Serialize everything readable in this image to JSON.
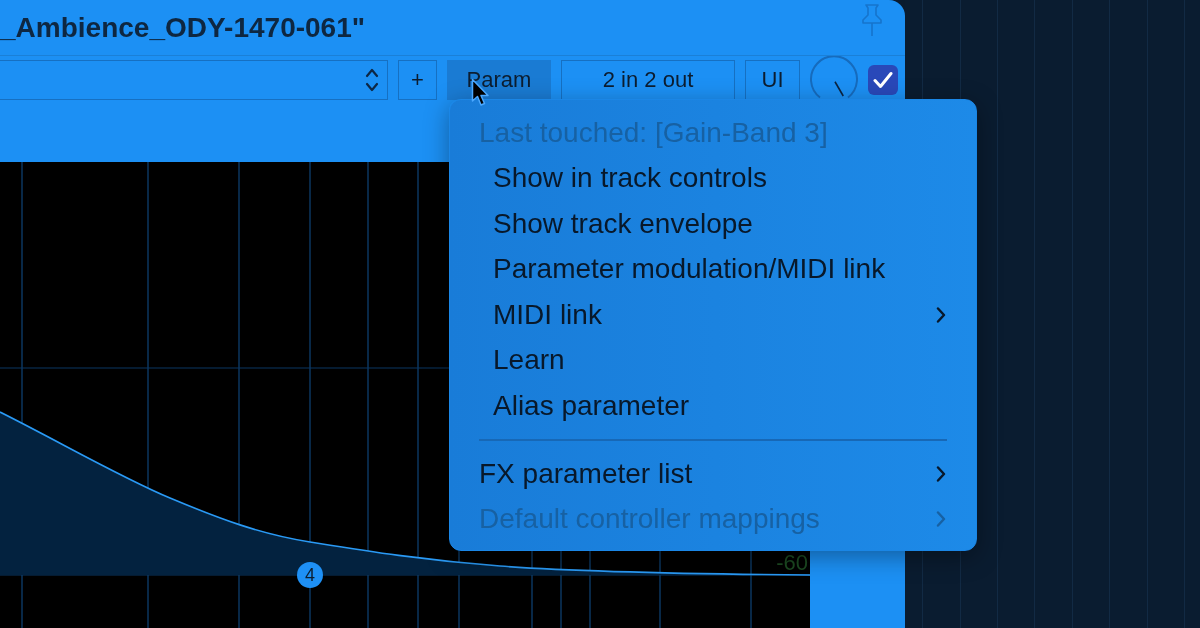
{
  "window": {
    "title": "_Ambience_ODY-1470-061\""
  },
  "toolbar": {
    "buttons": [
      {
        "label": "+",
        "pressed": false
      },
      {
        "label": "Param",
        "pressed": true
      },
      {
        "label": "2 in 2 out",
        "pressed": false
      },
      {
        "label": "UI",
        "pressed": false
      }
    ],
    "knob": {
      "level": 1
    },
    "checkbox": {
      "checked": true
    }
  },
  "graph": {
    "band_marker": "4",
    "scale_label": "-60"
  },
  "context_menu": {
    "items": [
      {
        "kind": "item",
        "label": "Last touched: [Gain-Band 3]",
        "disabled": true,
        "submenu": false,
        "children": [
          {
            "kind": "item",
            "label": "Show in track controls",
            "disabled": false,
            "submenu": false
          },
          {
            "kind": "item",
            "label": "Show track envelope",
            "disabled": false,
            "submenu": false
          },
          {
            "kind": "item",
            "label": "Parameter modulation/MIDI link",
            "disabled": false,
            "submenu": false
          },
          {
            "kind": "item",
            "label": "MIDI link",
            "disabled": false,
            "submenu": true
          },
          {
            "kind": "item",
            "label": "Learn",
            "disabled": false,
            "submenu": false
          },
          {
            "kind": "item",
            "label": "Alias parameter",
            "disabled": false,
            "submenu": false
          }
        ]
      },
      {
        "kind": "separator"
      },
      {
        "kind": "item",
        "label": "FX parameter list",
        "disabled": false,
        "submenu": true
      },
      {
        "kind": "item",
        "label": "Default controller mappings",
        "disabled": true,
        "submenu": true
      }
    ]
  }
}
